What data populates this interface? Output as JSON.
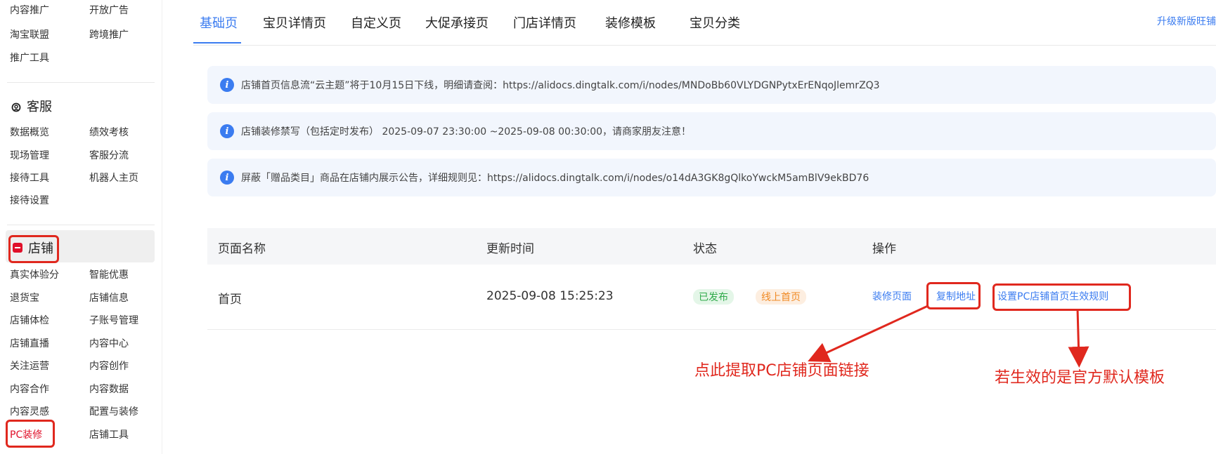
{
  "sidebar": {
    "top_items": [
      {
        "label": "内容推广",
        "col": 0
      },
      {
        "label": "开放广告",
        "col": 1
      },
      {
        "label": "淘宝联盟",
        "col": 0
      },
      {
        "label": "跨境推广",
        "col": 1
      },
      {
        "label": "推广工具",
        "col": 0
      }
    ],
    "customer_service": {
      "title": "客服",
      "items": [
        "数据概览",
        "绩效考核",
        "现场管理",
        "客服分流",
        "接待工具",
        "机器人主页",
        "接待设置"
      ]
    },
    "shop": {
      "title": "店铺",
      "items": [
        "真实体验分",
        "智能优惠",
        "退货宝",
        "店铺信息",
        "店铺体检",
        "子账号管理",
        "店铺直播",
        "内容中心",
        "关注运营",
        "内容创作",
        "内容合作",
        "内容数据",
        "内容灵感",
        "配置与装修",
        "PC装修",
        "店铺工具"
      ],
      "active_item": "PC装修"
    }
  },
  "tabs": {
    "items": [
      "基础页",
      "宝贝详情页",
      "自定义页",
      "大促承接页",
      "门店详情页",
      "装修模板",
      "宝贝分类"
    ],
    "active": "基础页",
    "upgrade_link": "升级新版旺铺"
  },
  "notices": [
    "店铺首页信息流“云主题”将于10月15日下线，明细请查阅：https://alidocs.dingtalk.com/i/nodes/MNDoBb60VLYDGNPytxErENqoJlemrZQ3",
    "店铺装修禁写（包括定时发布） 2025-09-07 23:30:00 ~2025-09-08 00:30:00，请商家朋友注意！",
    "屏蔽「赠品类目」商品在店铺内展示公告，详细规则见：https://alidocs.dingtalk.com/i/nodes/o14dA3GK8gQlkoYwckM5amBlV9ekBD76"
  ],
  "table": {
    "headers": {
      "name": "页面名称",
      "time": "更新时间",
      "status": "状态",
      "ops": "操作"
    },
    "rows": [
      {
        "name": "首页",
        "time": "2025-09-08 15:25:23",
        "status_badges": [
          "已发布",
          "线上首页"
        ],
        "ops": [
          "装修页面",
          "复制地址",
          "设置PC店铺首页生效规则"
        ]
      }
    ]
  },
  "annotations": {
    "copy_hint": "点此提取PC店铺页面链接",
    "rule_hint": "若生效的是官方默认模板"
  },
  "colors": {
    "accent": "#3b7cf0",
    "annotation_red": "#e0281e",
    "shop_icon_red": "#e0102a"
  }
}
